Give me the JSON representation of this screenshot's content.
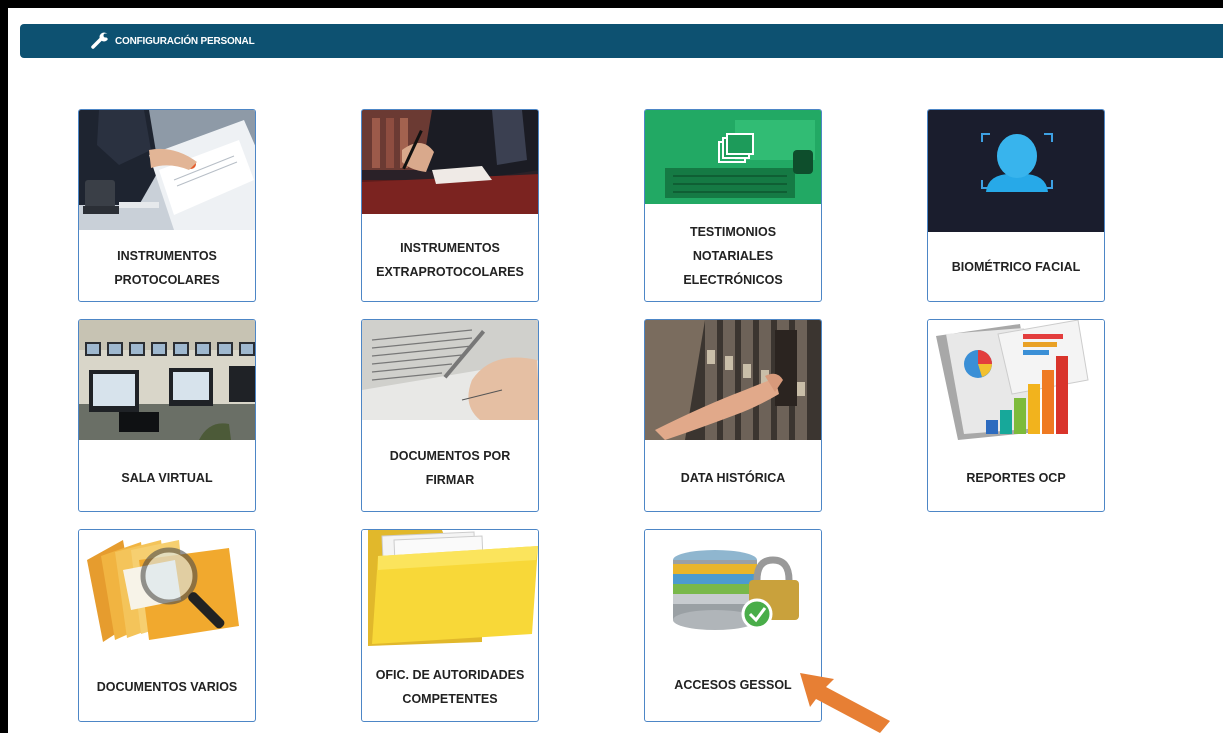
{
  "header": {
    "title": "CONFIGURACIÓN PERSONAL",
    "icon": "wrench-icon",
    "color": "#0d5171"
  },
  "accent_border": "#4d86c6",
  "annotation_arrow_color": "#e77f34",
  "cards": [
    {
      "label": "INSTRUMENTOS PROTOCOLARES",
      "image": "signing-document"
    },
    {
      "label": "INSTRUMENTOS EXTRAPROTOCOLARES",
      "image": "pen-signature"
    },
    {
      "label": "TESTIMONIOS NOTARIALES ELECTRÓNICOS",
      "image": "laptop-folders"
    },
    {
      "label": "BIOMÉTRICO FACIAL",
      "image": "face-scan"
    },
    {
      "label": "SALA VIRTUAL",
      "image": "computer-room"
    },
    {
      "label": "DOCUMENTOS POR FIRMAR",
      "image": "hand-pen"
    },
    {
      "label": "DATA HISTÓRICA",
      "image": "archive-files"
    },
    {
      "label": "REPORTES OCP",
      "image": "report-charts"
    },
    {
      "label": "DOCUMENTOS VARIOS",
      "image": "folders-magnifier"
    },
    {
      "label": "OFIC. DE AUTORIDADES COMPETENTES",
      "image": "yellow-folder"
    },
    {
      "label": "ACCESOS GESSOL",
      "image": "database-lock"
    }
  ]
}
